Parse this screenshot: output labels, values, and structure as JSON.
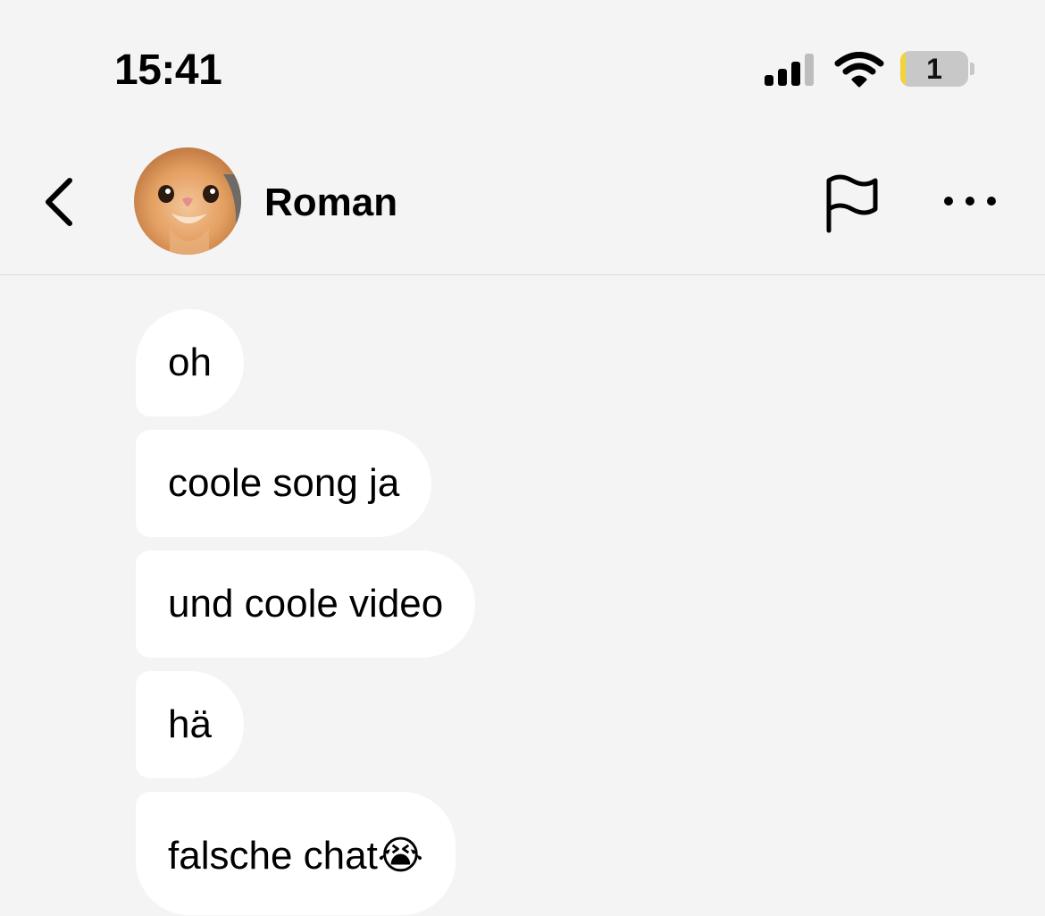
{
  "status_bar": {
    "time": "15:41",
    "battery_level": "1",
    "icons": [
      "cellular-signal-icon",
      "wifi-icon",
      "battery-icon"
    ]
  },
  "header": {
    "contact_name": "Roman",
    "icons": [
      "chevron-left-icon",
      "flag-icon",
      "more-horizontal-icon"
    ]
  },
  "messages": [
    {
      "text": "oh"
    },
    {
      "text": "coole song ja"
    },
    {
      "text": "und coole video"
    },
    {
      "text": "hä"
    },
    {
      "text": "falsche chat😭"
    }
  ],
  "colors": {
    "background": "#f4f4f4",
    "bubble": "#ffffff",
    "battery_low": "#f2d33a",
    "divider": "#dcdcdc"
  }
}
